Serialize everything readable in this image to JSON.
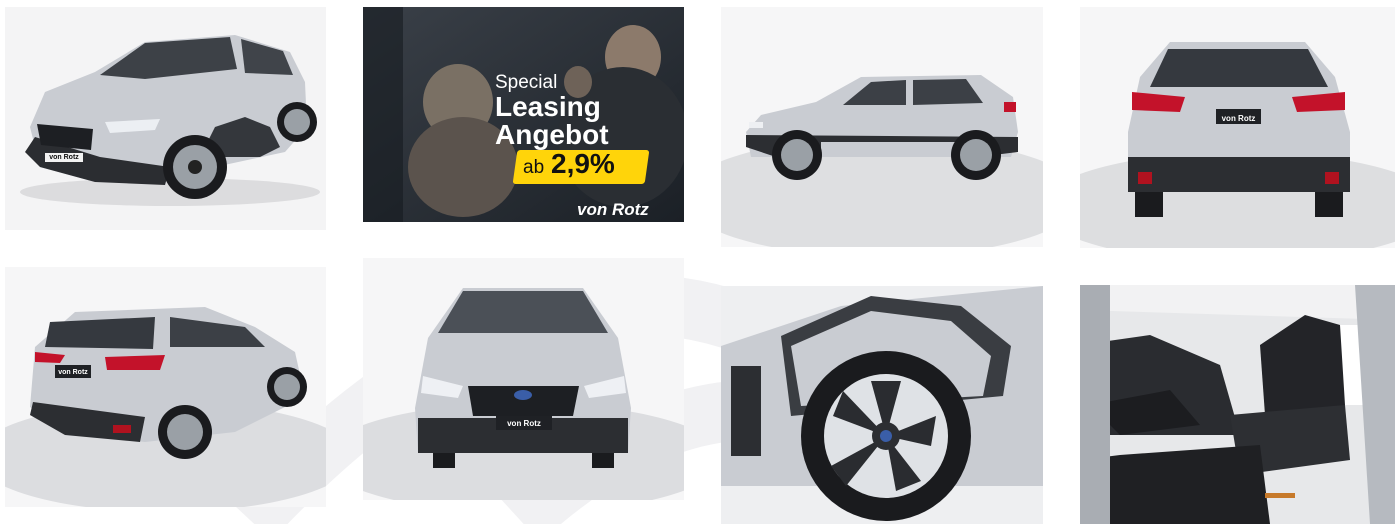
{
  "gallery": {
    "images": [
      {
        "name": "front-three-quarter"
      },
      {
        "name": "leasing-promo"
      },
      {
        "name": "side-profile"
      },
      {
        "name": "rear"
      },
      {
        "name": "rear-three-quarter"
      },
      {
        "name": "front"
      },
      {
        "name": "wheel-detail"
      },
      {
        "name": "interior-front-seats"
      }
    ],
    "promo": {
      "line1": "Special",
      "line2": "Leasing",
      "line3": "Angebot",
      "badge_prefix": "ab",
      "badge_rate": "2,9%",
      "brand": "von Rotz"
    },
    "plate_text": "von Rotz",
    "colors": {
      "car_body": "#c9ccd2",
      "promo_badge": "#ffd40a",
      "tail_light": "#c3122a"
    }
  }
}
